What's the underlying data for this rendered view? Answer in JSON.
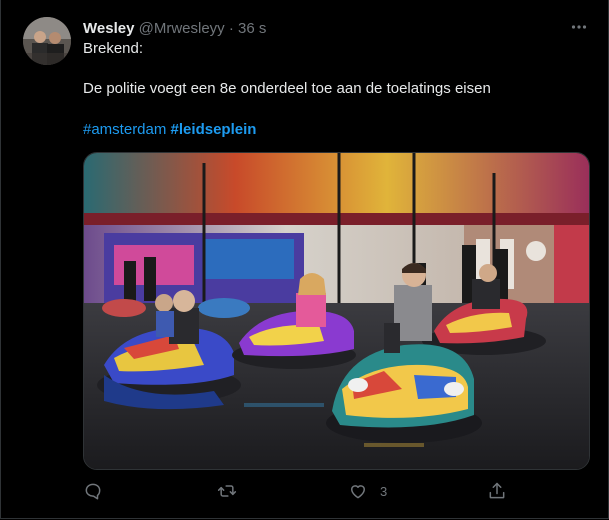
{
  "tweet": {
    "display_name": "Wesley",
    "handle": "@Mrwesleyy",
    "separator": "·",
    "time": "36 s",
    "line1": "Brekend:",
    "line2": "De politie voegt een 8e onderdeel toe aan de toelatings eisen",
    "hashtag1": "#amsterdam",
    "hashtag2": "#leidseplein",
    "media_icon": "photo-bumper-cars"
  },
  "actions": {
    "reply_icon": "reply-icon",
    "retweet_icon": "retweet-icon",
    "like_icon": "heart-icon",
    "like_count": "3",
    "share_icon": "share-icon"
  },
  "colors": {
    "background": "#000000",
    "text": "#e7e9ea",
    "muted": "#71767b",
    "link": "#1d9bf0",
    "border": "#2f3336"
  }
}
